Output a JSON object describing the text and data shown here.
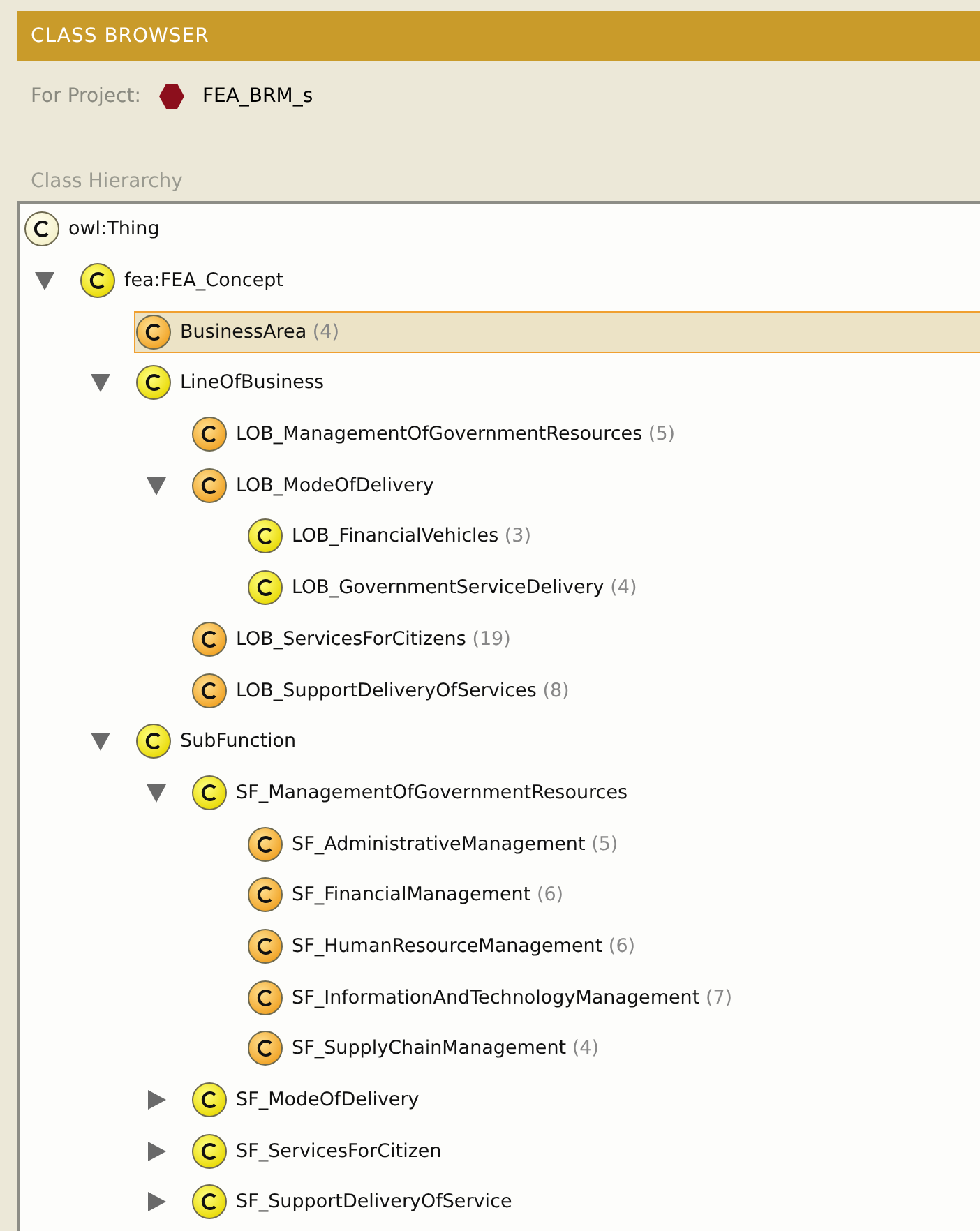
{
  "panel": {
    "title": "CLASS BROWSER",
    "project_label": "For Project:",
    "project_name": "FEA_BRM_s",
    "hierarchy_label": "Class Hierarchy"
  },
  "tree": [
    {
      "name": "owl:Thing",
      "kind": "plain",
      "selected": false,
      "children": [
        {
          "name": "fea:FEA_Concept",
          "kind": "yellow",
          "selected": false,
          "expanded": true,
          "children": [
            {
              "name": "BusinessArea",
              "count": "(4)",
              "kind": "orange",
              "selected": true
            },
            {
              "name": "LineOfBusiness",
              "kind": "yellow",
              "selected": false,
              "expanded": true,
              "children": [
                {
                  "name": "LOB_ManagementOfGovernmentResources",
                  "count": "(5)",
                  "kind": "orange",
                  "selected": false
                },
                {
                  "name": "LOB_ModeOfDelivery",
                  "kind": "orange",
                  "selected": false,
                  "expanded": true,
                  "children": [
                    {
                      "name": "LOB_FinancialVehicles",
                      "count": "(3)",
                      "kind": "yellow",
                      "selected": false
                    },
                    {
                      "name": "LOB_GovernmentServiceDelivery",
                      "count": "(4)",
                      "kind": "yellow",
                      "selected": false
                    }
                  ]
                },
                {
                  "name": "LOB_ServicesForCitizens",
                  "count": "(19)",
                  "kind": "orange",
                  "selected": false
                },
                {
                  "name": "LOB_SupportDeliveryOfServices",
                  "count": "(8)",
                  "kind": "orange",
                  "selected": false
                }
              ]
            },
            {
              "name": "SubFunction",
              "kind": "yellow",
              "selected": false,
              "expanded": true,
              "children": [
                {
                  "name": "SF_ManagementOfGovernmentResources",
                  "kind": "yellow",
                  "selected": false,
                  "expanded": true,
                  "children": [
                    {
                      "name": "SF_AdministrativeManagement",
                      "count": "(5)",
                      "kind": "orange",
                      "selected": false
                    },
                    {
                      "name": "SF_FinancialManagement",
                      "count": "(6)",
                      "kind": "orange",
                      "selected": false
                    },
                    {
                      "name": "SF_HumanResourceManagement",
                      "count": "(6)",
                      "kind": "orange",
                      "selected": false
                    },
                    {
                      "name": "SF_InformationAndTechnologyManagement",
                      "count": "(7)",
                      "kind": "orange",
                      "selected": false
                    },
                    {
                      "name": "SF_SupplyChainManagement",
                      "count": "(4)",
                      "kind": "orange",
                      "selected": false
                    }
                  ]
                },
                {
                  "name": "SF_ModeOfDelivery",
                  "kind": "yellow",
                  "selected": false,
                  "expanded": false
                },
                {
                  "name": "SF_ServicesForCitizen",
                  "kind": "yellow",
                  "selected": false,
                  "expanded": false
                },
                {
                  "name": "SF_SupportDeliveryOfService",
                  "kind": "yellow",
                  "selected": false,
                  "expanded": false
                }
              ]
            }
          ]
        }
      ]
    }
  ]
}
